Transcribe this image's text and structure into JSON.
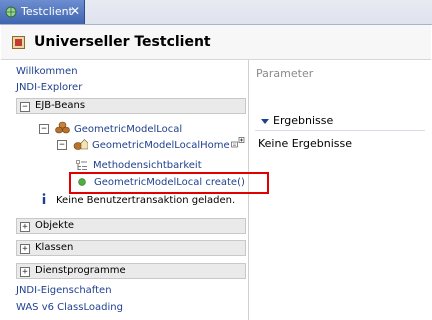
{
  "tab": {
    "label": "Testclient",
    "close": "✕"
  },
  "header": {
    "title": "Universeller Testclient"
  },
  "nav": {
    "welcome": "Willkommen",
    "jndi_explorer": "JNDI-Explorer",
    "jndi_properties": "JNDI-Eigenschaften",
    "classloading": "WAS v6 ClassLoading"
  },
  "sections": {
    "ejb": {
      "label": "EJB-Beans",
      "toggle": "−"
    },
    "objects": {
      "label": "Objekte",
      "toggle": "+"
    },
    "classes": {
      "label": "Klassen",
      "toggle": "+"
    },
    "services": {
      "label": "Dienstprogramme",
      "toggle": "+"
    }
  },
  "tree": {
    "root_label": "GeometricModelLocal",
    "root_toggle": "−",
    "home_label": "GeometricModelLocalHome",
    "home_toggle": "−",
    "visibility_label": "Methodensichtbarkeit",
    "create_label": "GeometricModelLocal create()",
    "info_text": "Keine Benutzertransaktion geladen."
  },
  "right": {
    "parameter_label": "Parameter",
    "results_label": "Ergebnisse",
    "results_empty": "Keine Ergebnisse"
  },
  "colors": {
    "link": "#1f3f8f",
    "highlight": "#e00000",
    "tab": "#3f65b0"
  }
}
